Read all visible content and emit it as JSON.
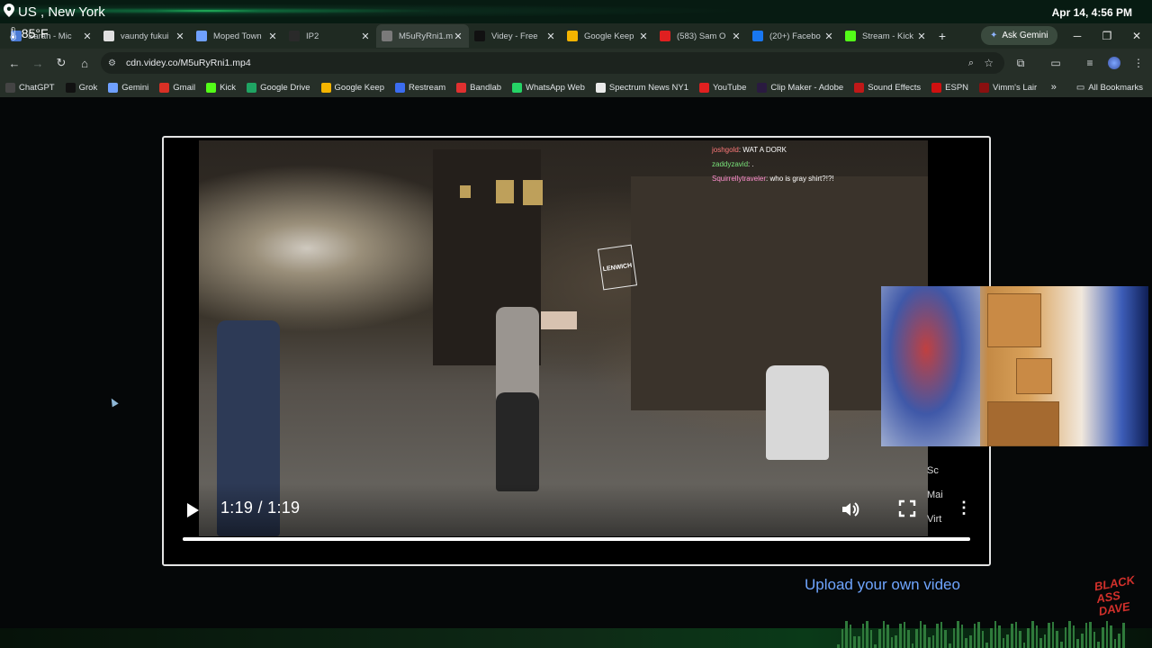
{
  "overlay": {
    "location": "US , New York",
    "temperature": "85°F",
    "datetime": "Apr 14, 4:56 PM"
  },
  "tabs": [
    {
      "label": "Sarah - Mic",
      "icon": "app-icon",
      "color": "#4a7bd6",
      "active": false
    },
    {
      "label": "vaundy fukui",
      "icon": "google-icon",
      "color": "#e0e0e0",
      "active": false
    },
    {
      "label": "Moped Town",
      "icon": "gemini-icon",
      "color": "#6fa0ff",
      "active": false
    },
    {
      "label": "IP2",
      "icon": "s-icon",
      "color": "#2a2a2a",
      "active": false
    },
    {
      "label": "M5uRyRni1.m",
      "icon": "globe-icon",
      "color": "#7a7a7a",
      "active": true
    },
    {
      "label": "Videy - Free",
      "icon": "v-icon",
      "color": "#111111",
      "active": false
    },
    {
      "label": "Google Keep",
      "icon": "keep-icon",
      "color": "#f4b400",
      "active": false
    },
    {
      "label": "(583) Sam O",
      "icon": "youtube-icon",
      "color": "#e02020",
      "active": false
    },
    {
      "label": "(20+) Facebo",
      "icon": "facebook-icon",
      "color": "#1877f2",
      "active": false
    },
    {
      "label": "Stream - Kick",
      "icon": "kick-icon",
      "color": "#53fc18",
      "active": false
    }
  ],
  "askGemini": "Ask Gemini",
  "address": {
    "url": "cdn.videy.co/M5uRyRni1.mp4"
  },
  "bookmarks": [
    {
      "label": "ChatGPT",
      "icon": "chatgpt-icon",
      "color": "#444"
    },
    {
      "label": "Grok",
      "icon": "grok-icon",
      "color": "#111"
    },
    {
      "label": "Gemini",
      "icon": "gemini-icon",
      "color": "#6fa0ff"
    },
    {
      "label": "Gmail",
      "icon": "gmail-icon",
      "color": "#d93025"
    },
    {
      "label": "Kick",
      "icon": "kick-icon",
      "color": "#53fc18"
    },
    {
      "label": "Google Drive",
      "icon": "drive-icon",
      "color": "#1fa463"
    },
    {
      "label": "Google Keep",
      "icon": "keep-icon",
      "color": "#f4b400"
    },
    {
      "label": "Restream",
      "icon": "restream-icon",
      "color": "#3b6cf0"
    },
    {
      "label": "Bandlab",
      "icon": "bandlab-icon",
      "color": "#e03030"
    },
    {
      "label": "WhatsApp Web",
      "icon": "whatsapp-icon",
      "color": "#25d366"
    },
    {
      "label": "Spectrum News NY1",
      "icon": "spectrum-icon",
      "color": "#eaeaea"
    },
    {
      "label": "YouTube",
      "icon": "youtube-icon",
      "color": "#e02020"
    },
    {
      "label": "Clip Maker - Adobe",
      "icon": "adobe-icon",
      "color": "#2a1a40"
    },
    {
      "label": "Sound Effects",
      "icon": "sound-icon",
      "color": "#c01818"
    },
    {
      "label": "ESPN",
      "icon": "espn-icon",
      "color": "#d01010"
    },
    {
      "label": "Vimm's Lair",
      "icon": "vimm-icon",
      "color": "#8a1010"
    }
  ],
  "allBookmarks": "All Bookmarks",
  "chat": [
    {
      "user": "joshgold",
      "msg": ": WAT A DORK"
    },
    {
      "user": "zaddyzavid",
      "msg": ": ."
    },
    {
      "user": "Squirrellytraveler",
      "msg": ": who is gray shirt?!?!"
    }
  ],
  "video": {
    "time": "1:19 / 1:19",
    "progress": 1.0,
    "sign": "LENWICH",
    "sideFragments": [
      "Sc",
      "Mai",
      "Virt"
    ]
  },
  "upload": "Upload your own video",
  "watermark": "BLACK ASS DAVE"
}
